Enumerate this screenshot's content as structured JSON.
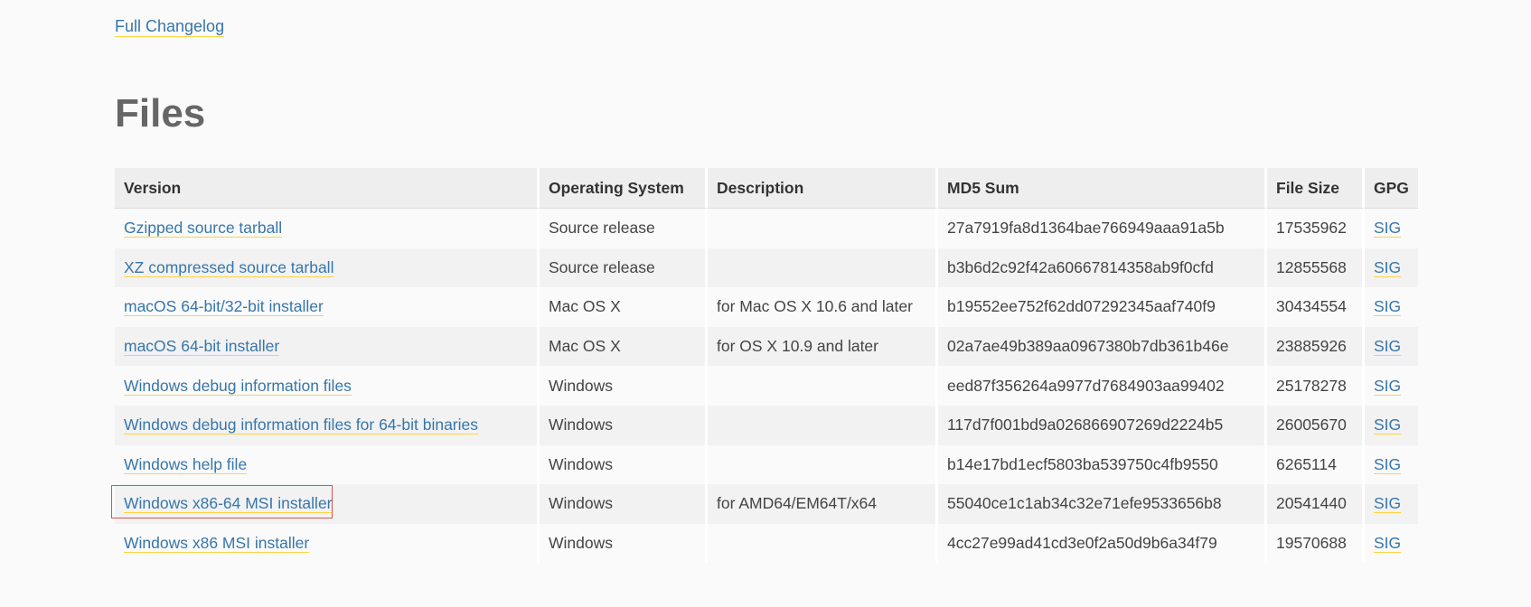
{
  "header": {
    "changelog_link": "Full Changelog",
    "section_title": "Files"
  },
  "table": {
    "columns": [
      "Version",
      "Operating System",
      "Description",
      "MD5 Sum",
      "File Size",
      "GPG"
    ],
    "rows": [
      {
        "version": "Gzipped source tarball",
        "os": "Source release",
        "description": "",
        "md5": "27a7919fa8d1364bae766949aaa91a5b",
        "size": "17535962",
        "gpg": "SIG"
      },
      {
        "version": "XZ compressed source tarball",
        "os": "Source release",
        "description": "",
        "md5": "b3b6d2c92f42a60667814358ab9f0cfd",
        "size": "12855568",
        "gpg": "SIG"
      },
      {
        "version": "macOS 64-bit/32-bit installer",
        "os": "Mac OS X",
        "description": "for Mac OS X 10.6 and later",
        "md5": "b19552ee752f62dd07292345aaf740f9",
        "size": "30434554",
        "gpg": "SIG"
      },
      {
        "version": "macOS 64-bit installer",
        "os": "Mac OS X",
        "description": "for OS X 10.9 and later",
        "md5": "02a7ae49b389aa0967380b7db361b46e",
        "size": "23885926",
        "gpg": "SIG"
      },
      {
        "version": "Windows debug information files",
        "os": "Windows",
        "description": "",
        "md5": "eed87f356264a9977d7684903aa99402",
        "size": "25178278",
        "gpg": "SIG"
      },
      {
        "version": "Windows debug information files for 64-bit binaries",
        "os": "Windows",
        "description": "",
        "md5": "117d7f001bd9a026866907269d2224b5",
        "size": "26005670",
        "gpg": "SIG"
      },
      {
        "version": "Windows help file",
        "os": "Windows",
        "description": "",
        "md5": "b14e17bd1ecf5803ba539750c4fb9550",
        "size": "6265114",
        "gpg": "SIG"
      },
      {
        "version": "Windows x86-64 MSI installer",
        "os": "Windows",
        "description": "for AMD64/EM64T/x64",
        "md5": "55040ce1c1ab34c32e71efe9533656b8",
        "size": "20541440",
        "gpg": "SIG"
      },
      {
        "version": "Windows x86 MSI installer",
        "os": "Windows",
        "description": "",
        "md5": "4cc27e99ad41cd3e0f2a50d9b6a34f79",
        "size": "19570688",
        "gpg": "SIG"
      }
    ]
  },
  "colors": {
    "link": "#3776ab",
    "link_underline": "#ffd343",
    "highlight_border": "#d9534f"
  }
}
